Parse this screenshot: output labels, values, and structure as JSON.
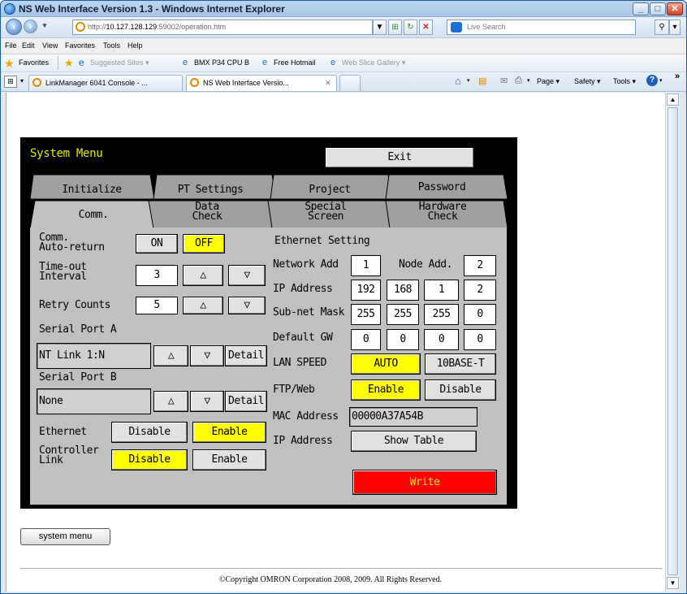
{
  "window": {
    "title": "NS Web Interface Version 1.3 - Windows Internet Explorer",
    "minimize": "_",
    "maximize": "□",
    "close": "✕"
  },
  "address": {
    "prefix": "http://",
    "host": "10.127.128.129",
    "path": ":59002/operation.htm",
    "search_placeholder": "Live Search"
  },
  "menu": [
    "File",
    "Edit",
    "View",
    "Favorites",
    "Tools",
    "Help"
  ],
  "favorites": {
    "label": "Favorites",
    "items": [
      "Suggested Sites ▾",
      "BMX P34 CPU B",
      "Free Hotmail",
      "Web Slice Gallery ▾"
    ]
  },
  "tabs": [
    {
      "label": "LinkManager 6041 Console - ..."
    },
    {
      "label": "NS Web Interface Versio..."
    }
  ],
  "commandbar": [
    "Page ▾",
    "Safety ▾",
    "Tools ▾"
  ],
  "panel": {
    "title": "System Menu",
    "exit": "Exit",
    "tabs_back": [
      "Initialize",
      "PT Settings",
      "Project",
      "Password"
    ],
    "tabs_front": [
      {
        "label": "Comm.",
        "active": true
      },
      {
        "label": "Data\nCheck",
        "active": false
      },
      {
        "label": "Special\nScreen",
        "active": false
      },
      {
        "label": "Hardware\nCheck",
        "active": false
      }
    ],
    "comm_auto_return": {
      "label": "Comm.\nAuto-return",
      "on": "ON",
      "off": "OFF",
      "selected": "OFF"
    },
    "timeout": {
      "label": "Time-out\nInterval",
      "value": "3"
    },
    "retry": {
      "label": "Retry Counts",
      "value": "5"
    },
    "up": "△",
    "down": "▽",
    "detail": "Detail",
    "serial_a": {
      "label": "Serial Port A",
      "value": "NT Link 1:N"
    },
    "serial_b": {
      "label": "Serial Port B",
      "value": "None"
    },
    "ethernet": {
      "label": "Ethernet",
      "disable": "Disable",
      "enable": "Enable",
      "selected": "Enable"
    },
    "controller_link": {
      "label": "Controller\nLink",
      "disable": "Disable",
      "enable": "Enable",
      "selected": "Disable"
    },
    "ethernet_setting": {
      "title": "Ethernet Setting",
      "network_add_label": "Network Add",
      "network_add": "1",
      "node_add_label": "Node Add.",
      "node_add": "2",
      "ip_label": "IP Address",
      "ip": [
        "192",
        "168",
        "1",
        "2"
      ],
      "subnet_label": "Sub-net Mask",
      "subnet": [
        "255",
        "255",
        "255",
        "0"
      ],
      "gw_label": "Default GW",
      "gw": [
        "0",
        "0",
        "0",
        "0"
      ],
      "lan_label": "LAN SPEED",
      "lan_auto": "AUTO",
      "lan_10": "10BASE-T",
      "ftp_label": "FTP/Web",
      "ftp_enable": "Enable",
      "ftp_disable": "Disable",
      "mac_label": "MAC Address",
      "mac": "00000A37A54B",
      "ip2_label": "IP Address",
      "show_table": "Show Table",
      "write": "Write"
    }
  },
  "system_menu_button": "system menu",
  "copyright": "©Copyright OMRON Corporation 2008, 2009. All Rights Reserved.",
  "colors": {
    "selected": "#ffff00",
    "write": "#ff0000",
    "title": "#e8e800",
    "panel_bg": "#000000",
    "tab_body": "#c0c0c0"
  }
}
